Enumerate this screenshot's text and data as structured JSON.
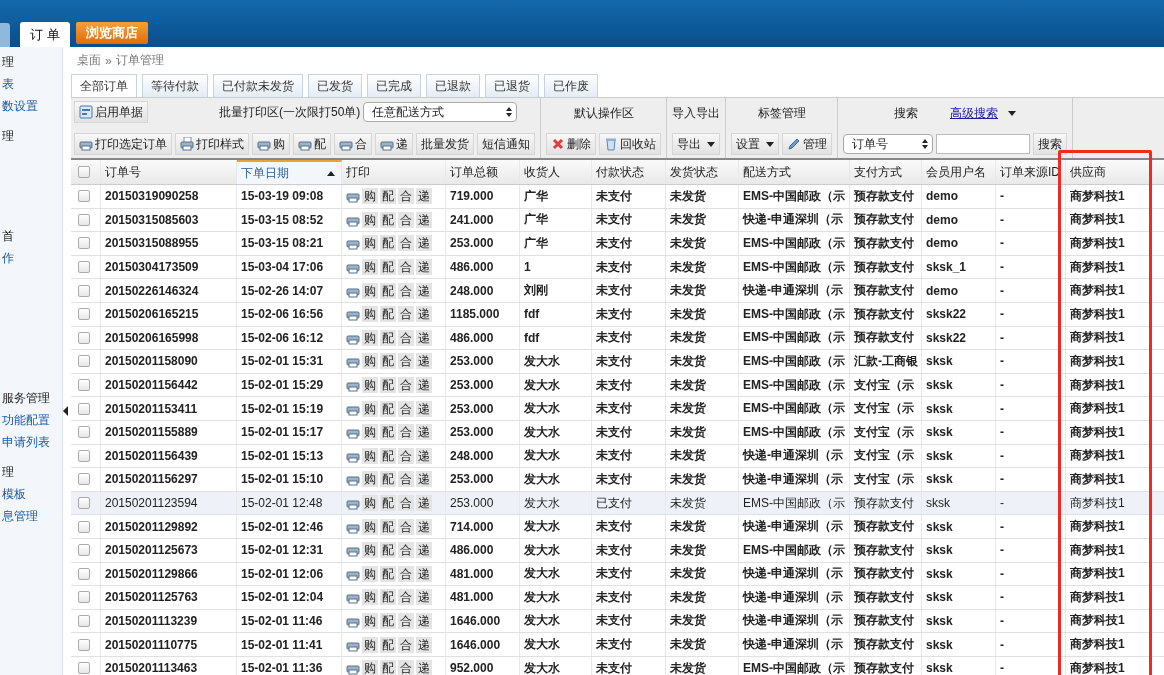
{
  "header": {
    "tabs": [
      {
        "label": "订 单",
        "selected": true
      }
    ],
    "shop_button": "浏览商店"
  },
  "sidebar": {
    "items": [
      {
        "text": "理",
        "kind": "heading"
      },
      {
        "text": "表",
        "kind": "link"
      },
      {
        "text": "数设置",
        "kind": "link"
      },
      {
        "text": "理",
        "kind": "heading"
      },
      {
        "text": "首",
        "kind": "heading"
      },
      {
        "text": "作",
        "kind": "link"
      },
      {
        "text": "服务管理",
        "kind": "heading"
      },
      {
        "text": "功能配置",
        "kind": "link"
      },
      {
        "text": "申请列表",
        "kind": "link"
      },
      {
        "text": "理",
        "kind": "heading"
      },
      {
        "text": "模板",
        "kind": "link"
      },
      {
        "text": "息管理",
        "kind": "link"
      }
    ]
  },
  "breadcrumb": [
    "桌面",
    "»",
    "订单管理"
  ],
  "tabs": [
    {
      "label": "全部订单",
      "selected": true
    },
    {
      "label": "等待付款",
      "selected": false
    },
    {
      "label": "已付款未发货",
      "selected": false
    },
    {
      "label": "已发货",
      "selected": false
    },
    {
      "label": "已完成",
      "selected": false
    },
    {
      "label": "已退款",
      "selected": false
    },
    {
      "label": "已退货",
      "selected": false
    },
    {
      "label": "已作废",
      "selected": false
    }
  ],
  "toolbar": {
    "enable_button": "启用单据",
    "batch_label": "批量打印区(一次限打50单)",
    "delivery_select": "任意配送方式",
    "print_buttons": [
      "打印选定订单",
      "打印样式",
      "购",
      "配",
      "合",
      "递",
      "批量发货",
      "短信通知"
    ],
    "sections": [
      {
        "title": "默认操作区",
        "buttons": [
          "删除",
          "回收站"
        ]
      },
      {
        "title": "导入导出",
        "buttons": [
          "导出"
        ]
      },
      {
        "title": "标签管理",
        "buttons": [
          "设置",
          "管理"
        ]
      }
    ],
    "search": {
      "title": "搜索",
      "advanced_link": "高级搜索",
      "field_select": "订单号",
      "button": "搜索"
    }
  },
  "table": {
    "columns": [
      {
        "label": "订单号",
        "sorted": false
      },
      {
        "label": "下单日期",
        "sorted": true
      },
      {
        "label": "打印",
        "sorted": false
      },
      {
        "label": "订单总额",
        "sorted": false
      },
      {
        "label": "收货人",
        "sorted": false
      },
      {
        "label": "付款状态",
        "sorted": false
      },
      {
        "label": "发货状态",
        "sorted": false
      },
      {
        "label": "配送方式",
        "sorted": false
      },
      {
        "label": "支付方式",
        "sorted": false
      },
      {
        "label": "会员用户名",
        "sorted": false
      },
      {
        "label": "订单来源ID",
        "sorted": false
      },
      {
        "label": "供应商",
        "sorted": false
      }
    ],
    "header_checked": false,
    "rows": [
      {
        "checked": false,
        "highlighted": false,
        "cells": [
          "20150319090258",
          "15-03-19 09:08",
          "",
          "719.000",
          "广华",
          "未支付",
          "未发货",
          "EMS-中国邮政（示",
          "预存款支付",
          "demo",
          "-",
          "商梦科技1"
        ],
        "print": [
          "购",
          "配",
          "合",
          "递"
        ]
      },
      {
        "checked": false,
        "highlighted": false,
        "cells": [
          "20150315085603",
          "15-03-15 08:52",
          "",
          "241.000",
          "广华",
          "未支付",
          "未发货",
          "快递-申通深圳（示",
          "预存款支付",
          "demo",
          "-",
          "商梦科技1"
        ],
        "print": [
          "购",
          "配",
          "合",
          "递"
        ]
      },
      {
        "checked": false,
        "highlighted": false,
        "cells": [
          "20150315088955",
          "15-03-15 08:21",
          "",
          "253.000",
          "广华",
          "未支付",
          "未发货",
          "EMS-中国邮政（示",
          "预存款支付",
          "demo",
          "-",
          "商梦科技1"
        ],
        "print": [
          "购",
          "配",
          "合",
          "递"
        ]
      },
      {
        "checked": false,
        "highlighted": false,
        "cells": [
          "20150304173509",
          "15-03-04 17:06",
          "",
          "486.000",
          "1",
          "未支付",
          "未发货",
          "EMS-中国邮政（示",
          "预存款支付",
          "sksk_1",
          "-",
          "商梦科技1"
        ],
        "print": [
          "购",
          "配",
          "合",
          "递"
        ]
      },
      {
        "checked": false,
        "highlighted": false,
        "cells": [
          "20150226146324",
          "15-02-26 14:07",
          "",
          "248.000",
          "刘刚",
          "未支付",
          "未发货",
          "快递-申通深圳（示",
          "预存款支付",
          "demo",
          "-",
          "商梦科技1"
        ],
        "print": [
          "购",
          "配",
          "合",
          "递"
        ]
      },
      {
        "checked": false,
        "highlighted": false,
        "cells": [
          "20150206165215",
          "15-02-06 16:56",
          "",
          "1185.000",
          "fdf",
          "未支付",
          "未发货",
          "EMS-中国邮政（示",
          "预存款支付",
          "sksk22",
          "-",
          "商梦科技1"
        ],
        "print": [
          "购",
          "配",
          "合",
          "递"
        ]
      },
      {
        "checked": false,
        "highlighted": false,
        "cells": [
          "20150206165998",
          "15-02-06 16:12",
          "",
          "486.000",
          "fdf",
          "未支付",
          "未发货",
          "EMS-中国邮政（示",
          "预存款支付",
          "sksk22",
          "-",
          "商梦科技1"
        ],
        "print": [
          "购",
          "配",
          "合",
          "递"
        ]
      },
      {
        "checked": false,
        "highlighted": false,
        "cells": [
          "20150201158090",
          "15-02-01 15:31",
          "",
          "253.000",
          "发大水",
          "未支付",
          "未发货",
          "EMS-中国邮政（示",
          "汇款-工商银",
          "sksk",
          "-",
          "商梦科技1"
        ],
        "print": [
          "购",
          "配",
          "合",
          "递"
        ]
      },
      {
        "checked": false,
        "highlighted": false,
        "cells": [
          "20150201156442",
          "15-02-01 15:29",
          "",
          "253.000",
          "发大水",
          "未支付",
          "未发货",
          "EMS-中国邮政（示",
          "支付宝（示",
          "sksk",
          "-",
          "商梦科技1"
        ],
        "print": [
          "购",
          "配",
          "合",
          "递"
        ]
      },
      {
        "checked": false,
        "highlighted": false,
        "cells": [
          "20150201153411",
          "15-02-01 15:19",
          "",
          "253.000",
          "发大水",
          "未支付",
          "未发货",
          "EMS-中国邮政（示",
          "支付宝（示",
          "sksk",
          "-",
          "商梦科技1"
        ],
        "print": [
          "购",
          "配",
          "合",
          "递"
        ]
      },
      {
        "checked": false,
        "highlighted": false,
        "cells": [
          "20150201155889",
          "15-02-01 15:17",
          "",
          "253.000",
          "发大水",
          "未支付",
          "未发货",
          "EMS-中国邮政（示",
          "支付宝（示",
          "sksk",
          "-",
          "商梦科技1"
        ],
        "print": [
          "购",
          "配",
          "合",
          "递"
        ]
      },
      {
        "checked": false,
        "highlighted": false,
        "cells": [
          "20150201156439",
          "15-02-01 15:13",
          "",
          "248.000",
          "发大水",
          "未支付",
          "未发货",
          "快递-申通深圳（示",
          "支付宝（示",
          "sksk",
          "-",
          "商梦科技1"
        ],
        "print": [
          "购",
          "配",
          "合",
          "递"
        ]
      },
      {
        "checked": false,
        "highlighted": false,
        "cells": [
          "20150201156297",
          "15-02-01 15:10",
          "",
          "253.000",
          "发大水",
          "未支付",
          "未发货",
          "快递-申通深圳（示",
          "支付宝（示",
          "sksk",
          "-",
          "商梦科技1"
        ],
        "print": [
          "购",
          "配",
          "合",
          "递"
        ]
      },
      {
        "checked": false,
        "highlighted": true,
        "cells": [
          "20150201123594",
          "15-02-01 12:48",
          "",
          "253.000",
          "发大水",
          "已支付",
          "未发货",
          "EMS-中国邮政（示",
          "预存款支付",
          "sksk",
          "-",
          "商梦科技1"
        ],
        "print": [
          "购",
          "配",
          "合",
          "递"
        ]
      },
      {
        "checked": false,
        "highlighted": false,
        "cells": [
          "20150201129892",
          "15-02-01 12:46",
          "",
          "714.000",
          "发大水",
          "未支付",
          "未发货",
          "快递-申通深圳（示",
          "预存款支付",
          "sksk",
          "-",
          "商梦科技1"
        ],
        "print": [
          "购",
          "配",
          "合",
          "递"
        ]
      },
      {
        "checked": false,
        "highlighted": false,
        "cells": [
          "20150201125673",
          "15-02-01 12:31",
          "",
          "486.000",
          "发大水",
          "未支付",
          "未发货",
          "EMS-中国邮政（示",
          "预存款支付",
          "sksk",
          "-",
          "商梦科技1"
        ],
        "print": [
          "购",
          "配",
          "合",
          "递"
        ]
      },
      {
        "checked": false,
        "highlighted": false,
        "cells": [
          "20150201129866",
          "15-02-01 12:06",
          "",
          "481.000",
          "发大水",
          "未支付",
          "未发货",
          "快递-申通深圳（示",
          "预存款支付",
          "sksk",
          "-",
          "商梦科技1"
        ],
        "print": [
          "购",
          "配",
          "合",
          "递"
        ]
      },
      {
        "checked": false,
        "highlighted": false,
        "cells": [
          "20150201125763",
          "15-02-01 12:04",
          "",
          "481.000",
          "发大水",
          "未支付",
          "未发货",
          "快递-申通深圳（示",
          "预存款支付",
          "sksk",
          "-",
          "商梦科技1"
        ],
        "print": [
          "购",
          "配",
          "合",
          "递"
        ]
      },
      {
        "checked": false,
        "highlighted": false,
        "cells": [
          "20150201113239",
          "15-02-01 11:46",
          "",
          "1646.000",
          "发大水",
          "未支付",
          "未发货",
          "快递-申通深圳（示",
          "预存款支付",
          "sksk",
          "-",
          "商梦科技1"
        ],
        "print": [
          "购",
          "配",
          "合",
          "递"
        ]
      },
      {
        "checked": false,
        "highlighted": false,
        "cells": [
          "20150201110775",
          "15-02-01 11:41",
          "",
          "1646.000",
          "发大水",
          "未支付",
          "未发货",
          "快递-申通深圳（示",
          "预存款支付",
          "sksk",
          "-",
          "商梦科技1"
        ],
        "print": [
          "购",
          "配",
          "合",
          "递"
        ]
      },
      {
        "checked": false,
        "highlighted": false,
        "cells": [
          "20150201113463",
          "15-02-01 11:36",
          "",
          "952.000",
          "发大水",
          "未支付",
          "未发货",
          "EMS-中国邮政（示",
          "预存款支付",
          "sksk",
          "-",
          "商梦科技1"
        ],
        "print": [
          "购",
          "配",
          "合",
          "递"
        ]
      }
    ]
  }
}
